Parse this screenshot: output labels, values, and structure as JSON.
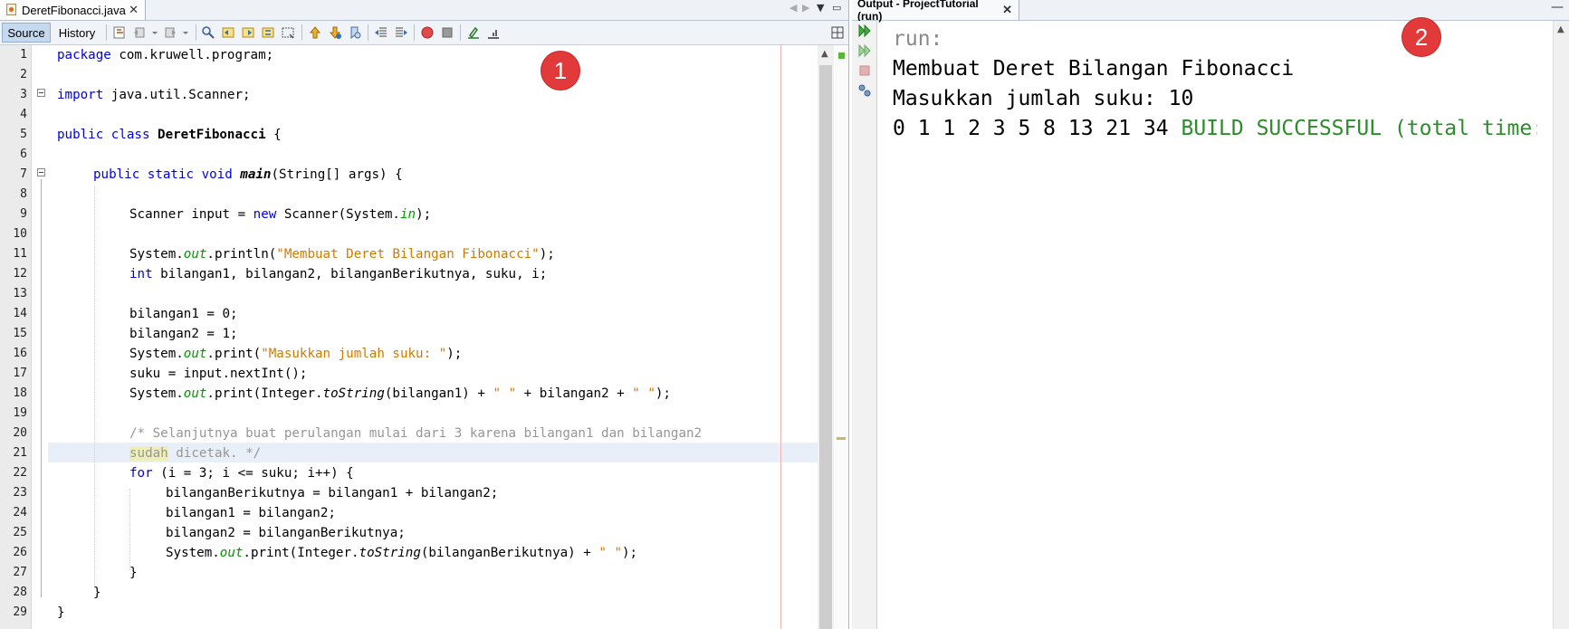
{
  "editor": {
    "tab_title": "DeretFibonacci.java",
    "tab_close": "✕",
    "source_tab": "Source",
    "history_tab": "History",
    "badge": "1",
    "line_numbers": [
      "1",
      "2",
      "3",
      "4",
      "5",
      "6",
      "7",
      "8",
      "9",
      "10",
      "11",
      "12",
      "13",
      "14",
      "15",
      "16",
      "17",
      "18",
      "19",
      "20",
      "21",
      "22",
      "23",
      "24",
      "25",
      "26",
      "27",
      "28",
      "29"
    ],
    "code": {
      "l1_kw": "package",
      "l1_rest": " com.kruwell.program;",
      "l3_kw": "import",
      "l3_rest": " java.util.Scanner;",
      "l5_kw": "public class",
      "l5_cls": "DeretFibonacci",
      "l5_rest": " {",
      "l7_kw": "public static void",
      "l7_mth": "main",
      "l7_rest": "(String[] args) {",
      "l9_a": "Scanner input = ",
      "l9_kw": "new",
      "l9_b": " Scanner(System.",
      "l9_fld": "in",
      "l9_c": ");",
      "l11_a": "System.",
      "l11_fld": "out",
      "l11_b": ".println(",
      "l11_str": "\"Membuat Deret Bilangan Fibonacci\"",
      "l11_c": ");",
      "l12_kw": "int",
      "l12_rest": " bilangan1, bilangan2, bilanganBerikutnya, suku, i;",
      "l14": "bilangan1 = 0;",
      "l15": "bilangan2 = 1;",
      "l16_a": "System.",
      "l16_fld": "out",
      "l16_b": ".print(",
      "l16_str": "\"Masukkan jumlah suku: \"",
      "l16_c": ");",
      "l17": "suku = input.nextInt();",
      "l18_a": "System.",
      "l18_fld": "out",
      "l18_b": ".print(Integer.",
      "l18_st": "toString",
      "l18_c": "(bilangan1) + ",
      "l18_str1": "\" \"",
      "l18_d": " + bilangan2 + ",
      "l18_str2": "\" \"",
      "l18_e": ");",
      "l20": "/* Selanjutnya buat perulangan mulai dari 3 karena bilangan1 dan bilangan2",
      "l21_mark": "sudah",
      "l21_rest": " dicetak. */",
      "l22_kw": "for",
      "l22_rest": " (i = 3; i <= suku; i++) {",
      "l23": "bilanganBerikutnya = bilangan1 + bilangan2;",
      "l24": "bilangan1 = bilangan2;",
      "l25": "bilangan2 = bilanganBerikutnya;",
      "l26_a": "System.",
      "l26_fld": "out",
      "l26_b": ".print(Integer.",
      "l26_st": "toString",
      "l26_c": "(bilanganBerikutnya) + ",
      "l26_str": "\" \"",
      "l26_d": ");",
      "l27": "}",
      "l28": "}",
      "l29": "}"
    }
  },
  "output": {
    "tab_title": "Output - ProjectTutorial (run)",
    "tab_close": "✕",
    "badge": "2",
    "lines": {
      "run": "run:",
      "title": "Membuat Deret Bilangan Fibonacci",
      "prompt": "Masukkan jumlah suku: 10",
      "series": "0 1 1 2 3 5 8 13 21 34 ",
      "build": "BUILD SUCCESSFUL (total time:"
    }
  },
  "colors": {
    "keyword": "#0000e6",
    "string": "#ce7b00",
    "field": "#009900",
    "comment": "#969696",
    "build_success": "#2e8b2e",
    "badge": "#e23a3a"
  },
  "icons": [
    "java-file-icon",
    "back-icon",
    "forward-icon",
    "find-icon",
    "toggle-bookmark-icon",
    "shift-left-icon",
    "shift-right-icon",
    "start-macro-icon",
    "stop-macro-icon",
    "run-again-icon",
    "rerun-icon",
    "stop-icon",
    "settings-icon"
  ]
}
